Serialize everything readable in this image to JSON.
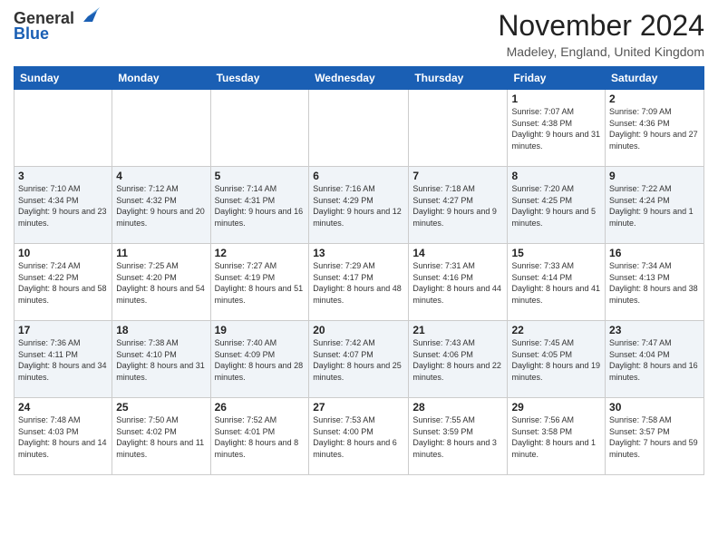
{
  "header": {
    "logo_line1": "General",
    "logo_line2": "Blue",
    "month_title": "November 2024",
    "location": "Madeley, England, United Kingdom"
  },
  "weekdays": [
    "Sunday",
    "Monday",
    "Tuesday",
    "Wednesday",
    "Thursday",
    "Friday",
    "Saturday"
  ],
  "weeks": [
    [
      {
        "day": "",
        "sunrise": "",
        "sunset": "",
        "daylight": ""
      },
      {
        "day": "",
        "sunrise": "",
        "sunset": "",
        "daylight": ""
      },
      {
        "day": "",
        "sunrise": "",
        "sunset": "",
        "daylight": ""
      },
      {
        "day": "",
        "sunrise": "",
        "sunset": "",
        "daylight": ""
      },
      {
        "day": "",
        "sunrise": "",
        "sunset": "",
        "daylight": ""
      },
      {
        "day": "1",
        "sunrise": "Sunrise: 7:07 AM",
        "sunset": "Sunset: 4:38 PM",
        "daylight": "Daylight: 9 hours and 31 minutes."
      },
      {
        "day": "2",
        "sunrise": "Sunrise: 7:09 AM",
        "sunset": "Sunset: 4:36 PM",
        "daylight": "Daylight: 9 hours and 27 minutes."
      }
    ],
    [
      {
        "day": "3",
        "sunrise": "Sunrise: 7:10 AM",
        "sunset": "Sunset: 4:34 PM",
        "daylight": "Daylight: 9 hours and 23 minutes."
      },
      {
        "day": "4",
        "sunrise": "Sunrise: 7:12 AM",
        "sunset": "Sunset: 4:32 PM",
        "daylight": "Daylight: 9 hours and 20 minutes."
      },
      {
        "day": "5",
        "sunrise": "Sunrise: 7:14 AM",
        "sunset": "Sunset: 4:31 PM",
        "daylight": "Daylight: 9 hours and 16 minutes."
      },
      {
        "day": "6",
        "sunrise": "Sunrise: 7:16 AM",
        "sunset": "Sunset: 4:29 PM",
        "daylight": "Daylight: 9 hours and 12 minutes."
      },
      {
        "day": "7",
        "sunrise": "Sunrise: 7:18 AM",
        "sunset": "Sunset: 4:27 PM",
        "daylight": "Daylight: 9 hours and 9 minutes."
      },
      {
        "day": "8",
        "sunrise": "Sunrise: 7:20 AM",
        "sunset": "Sunset: 4:25 PM",
        "daylight": "Daylight: 9 hours and 5 minutes."
      },
      {
        "day": "9",
        "sunrise": "Sunrise: 7:22 AM",
        "sunset": "Sunset: 4:24 PM",
        "daylight": "Daylight: 9 hours and 1 minute."
      }
    ],
    [
      {
        "day": "10",
        "sunrise": "Sunrise: 7:24 AM",
        "sunset": "Sunset: 4:22 PM",
        "daylight": "Daylight: 8 hours and 58 minutes."
      },
      {
        "day": "11",
        "sunrise": "Sunrise: 7:25 AM",
        "sunset": "Sunset: 4:20 PM",
        "daylight": "Daylight: 8 hours and 54 minutes."
      },
      {
        "day": "12",
        "sunrise": "Sunrise: 7:27 AM",
        "sunset": "Sunset: 4:19 PM",
        "daylight": "Daylight: 8 hours and 51 minutes."
      },
      {
        "day": "13",
        "sunrise": "Sunrise: 7:29 AM",
        "sunset": "Sunset: 4:17 PM",
        "daylight": "Daylight: 8 hours and 48 minutes."
      },
      {
        "day": "14",
        "sunrise": "Sunrise: 7:31 AM",
        "sunset": "Sunset: 4:16 PM",
        "daylight": "Daylight: 8 hours and 44 minutes."
      },
      {
        "day": "15",
        "sunrise": "Sunrise: 7:33 AM",
        "sunset": "Sunset: 4:14 PM",
        "daylight": "Daylight: 8 hours and 41 minutes."
      },
      {
        "day": "16",
        "sunrise": "Sunrise: 7:34 AM",
        "sunset": "Sunset: 4:13 PM",
        "daylight": "Daylight: 8 hours and 38 minutes."
      }
    ],
    [
      {
        "day": "17",
        "sunrise": "Sunrise: 7:36 AM",
        "sunset": "Sunset: 4:11 PM",
        "daylight": "Daylight: 8 hours and 34 minutes."
      },
      {
        "day": "18",
        "sunrise": "Sunrise: 7:38 AM",
        "sunset": "Sunset: 4:10 PM",
        "daylight": "Daylight: 8 hours and 31 minutes."
      },
      {
        "day": "19",
        "sunrise": "Sunrise: 7:40 AM",
        "sunset": "Sunset: 4:09 PM",
        "daylight": "Daylight: 8 hours and 28 minutes."
      },
      {
        "day": "20",
        "sunrise": "Sunrise: 7:42 AM",
        "sunset": "Sunset: 4:07 PM",
        "daylight": "Daylight: 8 hours and 25 minutes."
      },
      {
        "day": "21",
        "sunrise": "Sunrise: 7:43 AM",
        "sunset": "Sunset: 4:06 PM",
        "daylight": "Daylight: 8 hours and 22 minutes."
      },
      {
        "day": "22",
        "sunrise": "Sunrise: 7:45 AM",
        "sunset": "Sunset: 4:05 PM",
        "daylight": "Daylight: 8 hours and 19 minutes."
      },
      {
        "day": "23",
        "sunrise": "Sunrise: 7:47 AM",
        "sunset": "Sunset: 4:04 PM",
        "daylight": "Daylight: 8 hours and 16 minutes."
      }
    ],
    [
      {
        "day": "24",
        "sunrise": "Sunrise: 7:48 AM",
        "sunset": "Sunset: 4:03 PM",
        "daylight": "Daylight: 8 hours and 14 minutes."
      },
      {
        "day": "25",
        "sunrise": "Sunrise: 7:50 AM",
        "sunset": "Sunset: 4:02 PM",
        "daylight": "Daylight: 8 hours and 11 minutes."
      },
      {
        "day": "26",
        "sunrise": "Sunrise: 7:52 AM",
        "sunset": "Sunset: 4:01 PM",
        "daylight": "Daylight: 8 hours and 8 minutes."
      },
      {
        "day": "27",
        "sunrise": "Sunrise: 7:53 AM",
        "sunset": "Sunset: 4:00 PM",
        "daylight": "Daylight: 8 hours and 6 minutes."
      },
      {
        "day": "28",
        "sunrise": "Sunrise: 7:55 AM",
        "sunset": "Sunset: 3:59 PM",
        "daylight": "Daylight: 8 hours and 3 minutes."
      },
      {
        "day": "29",
        "sunrise": "Sunrise: 7:56 AM",
        "sunset": "Sunset: 3:58 PM",
        "daylight": "Daylight: 8 hours and 1 minute."
      },
      {
        "day": "30",
        "sunrise": "Sunrise: 7:58 AM",
        "sunset": "Sunset: 3:57 PM",
        "daylight": "Daylight: 7 hours and 59 minutes."
      }
    ]
  ]
}
